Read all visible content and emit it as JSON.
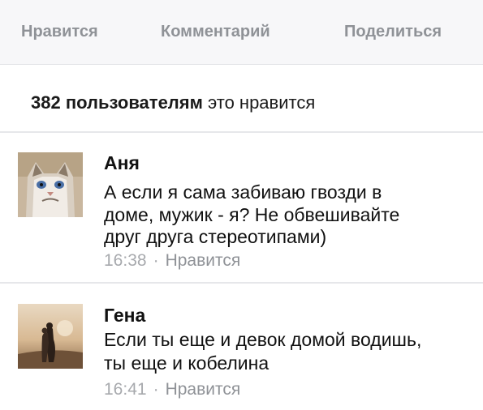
{
  "actions": {
    "like": "Нравится",
    "comment": "Комментарий",
    "share": "Поделиться"
  },
  "likes": {
    "count": "382 пользователям",
    "suffix": " это нравится"
  },
  "comments": [
    {
      "author": "Аня",
      "avatar_icon": "grumpy-cat-avatar",
      "lines": [
        "А если я сама забиваю гвозди в",
        "доме, мужик - я? Не обвешивайте",
        "друг друга стереотипами)"
      ],
      "time": "16:38",
      "separator": "·",
      "like_label": "Нравится"
    },
    {
      "author": "Гена",
      "avatar_icon": "couple-sunset-avatar",
      "lines": [
        "Если ты еще и девок домой водишь,",
        "ты еще и кобелина"
      ],
      "time": "16:41",
      "separator": "·",
      "like_label": "Нравится"
    }
  ]
}
